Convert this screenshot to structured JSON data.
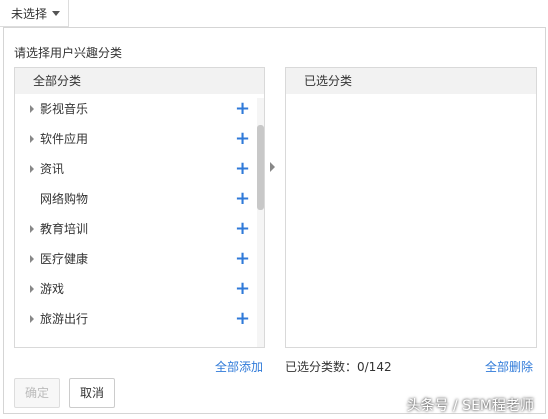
{
  "dropdown": {
    "label": "未选择"
  },
  "panel": {
    "prompt": "请选择用户兴趣分类",
    "left": {
      "header": "全部分类",
      "items": [
        {
          "label": "影视音乐",
          "expandable": true
        },
        {
          "label": "软件应用",
          "expandable": true
        },
        {
          "label": "资讯",
          "expandable": true
        },
        {
          "label": "网络购物",
          "expandable": false
        },
        {
          "label": "教育培训",
          "expandable": true
        },
        {
          "label": "医疗健康",
          "expandable": true
        },
        {
          "label": "游戏",
          "expandable": true
        },
        {
          "label": "旅游出行",
          "expandable": true
        }
      ],
      "add_icon": "+",
      "add_all": "全部添加"
    },
    "right": {
      "header": "已选分类",
      "count_label": "已选分类数：0/142",
      "delete_all": "全部删除"
    },
    "buttons": {
      "ok": "确定",
      "cancel": "取消"
    }
  },
  "watermark": "头条号 / SEM程老师",
  "colors": {
    "accent": "#2f7ad9",
    "header_bg": "#f2f2f2",
    "border": "#d9d9d9"
  }
}
